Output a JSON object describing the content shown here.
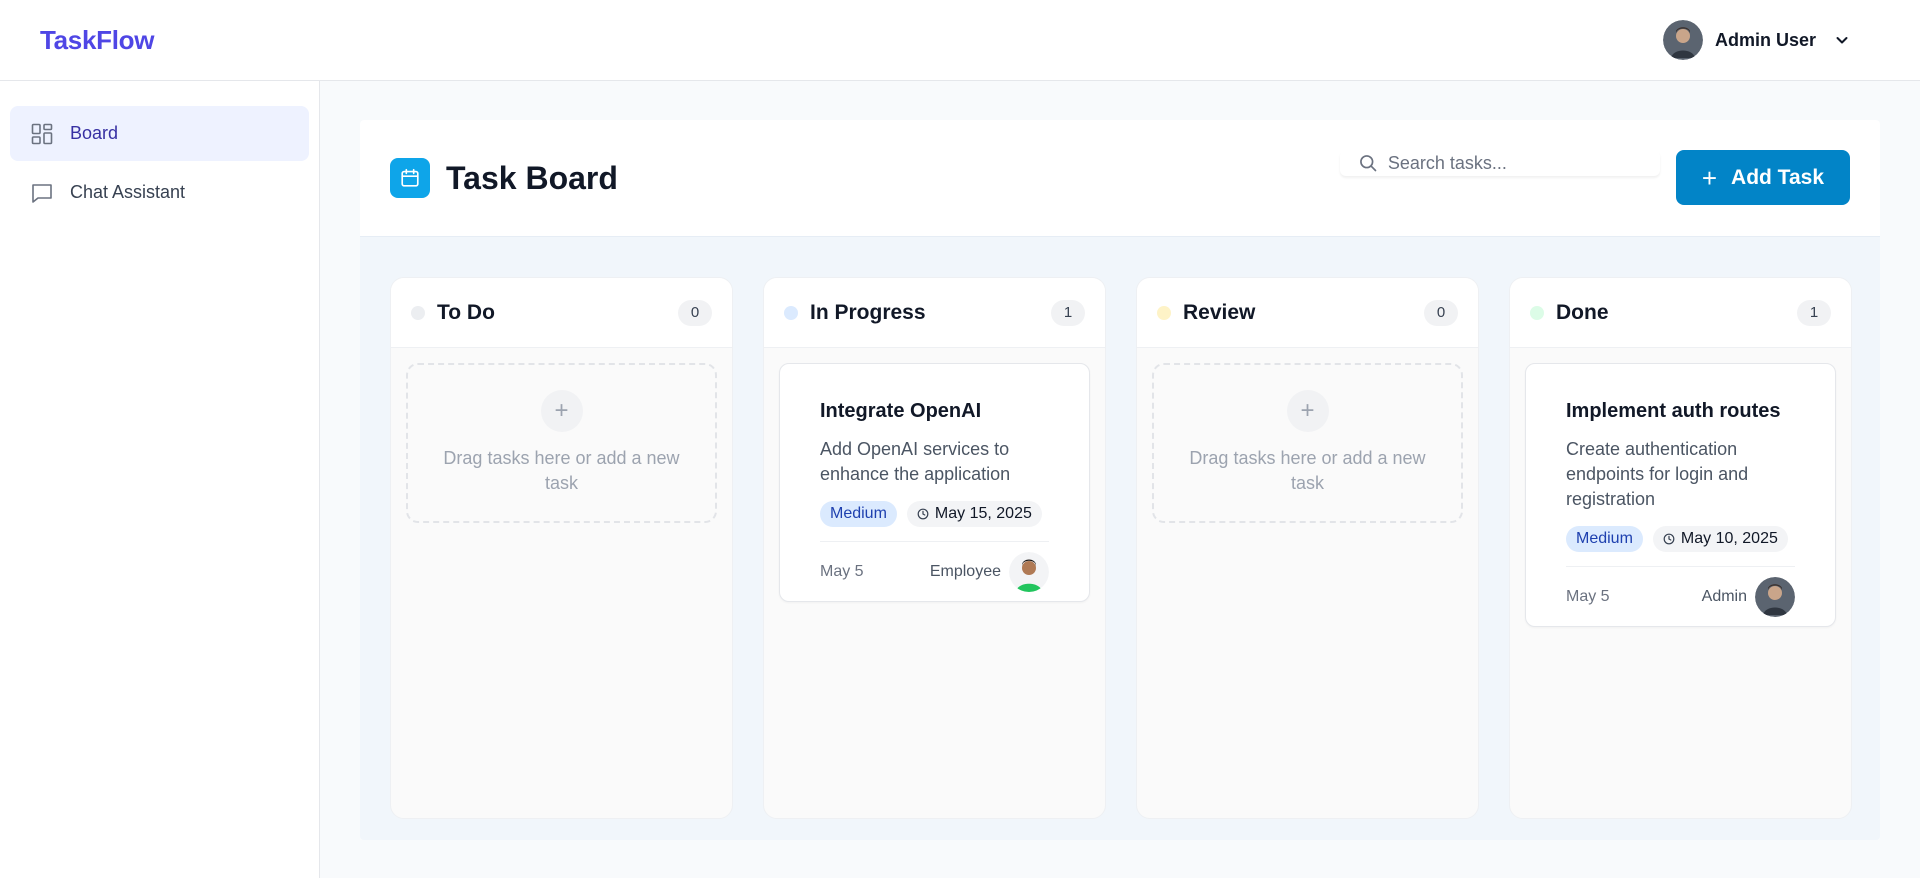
{
  "app": {
    "brand": "TaskFlow"
  },
  "user": {
    "name": "Admin User",
    "avatar": "admin-avatar"
  },
  "sidebar": {
    "items": [
      {
        "label": "Board",
        "icon": "grid-icon",
        "active": true
      },
      {
        "label": "Chat Assistant",
        "icon": "chat-icon",
        "active": false
      }
    ]
  },
  "board": {
    "title": "Task Board",
    "search_placeholder": "Search tasks...",
    "add_label": "Add Task"
  },
  "columns": [
    {
      "title": "To Do",
      "count": "0",
      "color": "#eceef1",
      "empty_text": "Drag tasks here or add a new task"
    },
    {
      "title": "In Progress",
      "count": "1",
      "color": "#dbeafe"
    },
    {
      "title": "Review",
      "count": "0",
      "color": "#fef3c7",
      "empty_text": "Drag tasks here or add a new task"
    },
    {
      "title": "Done",
      "count": "1",
      "color": "#dcfce7"
    }
  ],
  "tasks": [
    {
      "title": "Integrate OpenAI",
      "description": "Add OpenAI services to enhance the application",
      "priority": "Medium",
      "due": "May 15, 2025",
      "created": "May 5",
      "assignee": "Employee"
    },
    {
      "title": "Implement auth routes",
      "description": "Create authentication endpoints for login and registration",
      "priority": "Medium",
      "due": "May 10, 2025",
      "created": "May 5",
      "assignee": "Admin"
    }
  ]
}
